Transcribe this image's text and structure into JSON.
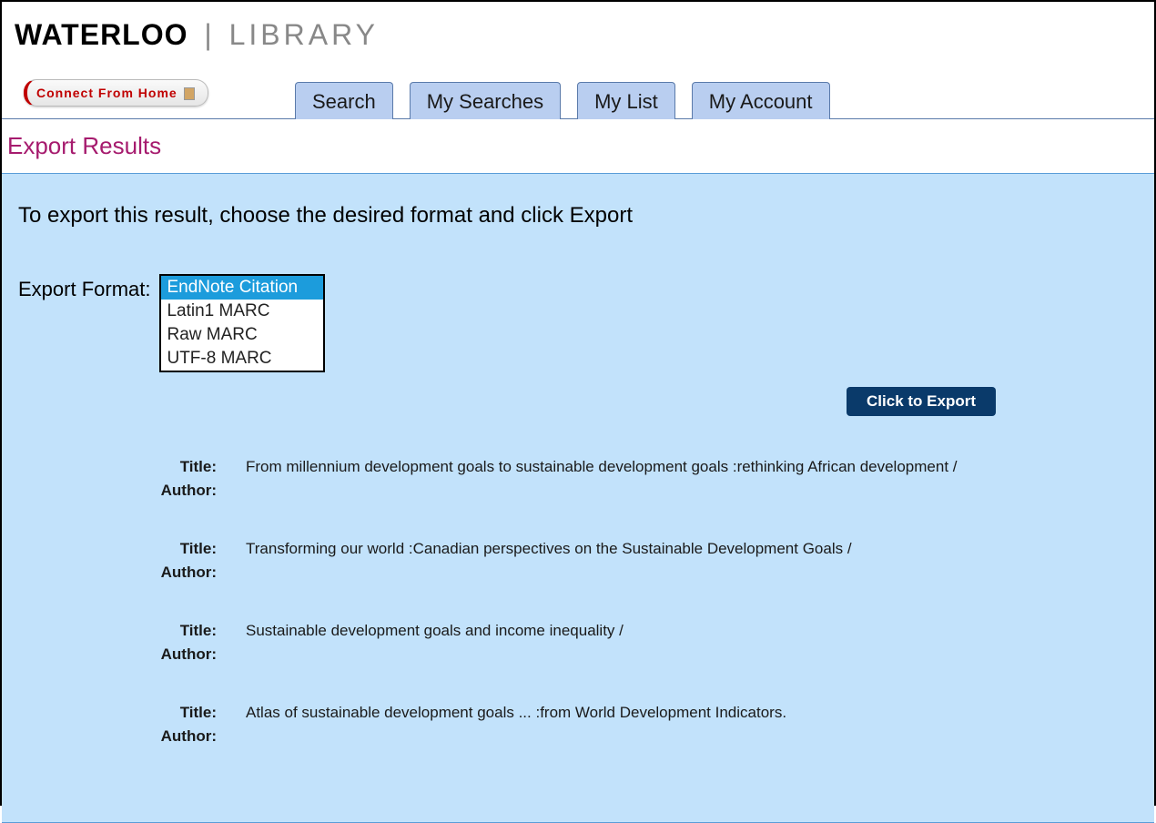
{
  "logo": {
    "waterloo": "WATERLOO",
    "library": "LIBRARY"
  },
  "connect_from_home": "Connect From Home",
  "nav": {
    "tabs": [
      {
        "label": "Search"
      },
      {
        "label": "My Searches"
      },
      {
        "label": "My List"
      },
      {
        "label": "My Account"
      }
    ]
  },
  "page_title": "Export Results",
  "instruction": "To export this result, choose the desired format and click Export",
  "export_format_label": "Export Format:",
  "export_format_options": [
    {
      "label": "EndNote Citation",
      "selected": true
    },
    {
      "label": "Latin1 MARC",
      "selected": false
    },
    {
      "label": "Raw MARC",
      "selected": false
    },
    {
      "label": "UTF-8 MARC",
      "selected": false
    }
  ],
  "export_button": "Click to Export",
  "field_labels": {
    "title": "Title:",
    "author": "Author:"
  },
  "results": [
    {
      "title": "From millennium development goals to sustainable development goals :rethinking African development /",
      "author": ""
    },
    {
      "title": "Transforming our world :Canadian perspectives on the Sustainable Development Goals /",
      "author": ""
    },
    {
      "title": "Sustainable development goals and income inequality /",
      "author": ""
    },
    {
      "title": "Atlas of sustainable development goals ... :from World Development Indicators.",
      "author": ""
    }
  ]
}
